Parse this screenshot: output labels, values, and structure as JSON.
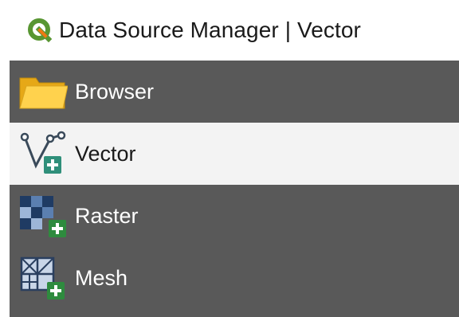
{
  "window": {
    "title": "Data Source Manager | Vector",
    "app_icon": "qgis-logo-icon"
  },
  "sidebar": {
    "items": [
      {
        "label": "Browser",
        "icon": "folder-icon",
        "selected": false
      },
      {
        "label": "Vector",
        "icon": "add-vector-layer-icon",
        "selected": true
      },
      {
        "label": "Raster",
        "icon": "add-raster-layer-icon",
        "selected": false
      },
      {
        "label": "Mesh",
        "icon": "add-mesh-layer-icon",
        "selected": false
      }
    ]
  },
  "colors": {
    "sidebar_bg": "#595959",
    "selected_bg": "#f3f3f3",
    "qgis_green": "#589632",
    "qgis_yellow": "#ee7913",
    "plus_badge": "#2e8b57",
    "folder_yellow": "#f5c542"
  }
}
